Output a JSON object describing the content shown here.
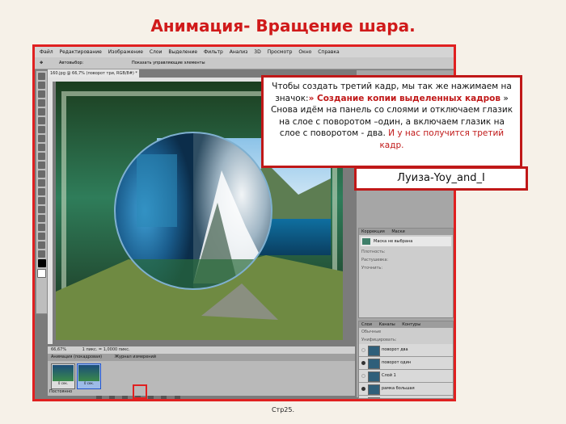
{
  "slide": {
    "title": "Анимация- Вращение шара.",
    "page_number": "Стр25."
  },
  "app": {
    "menu": [
      "Файл",
      "Редактирование",
      "Изображение",
      "Слои",
      "Выделение",
      "Фильтр",
      "Анализ",
      "3D",
      "Просмотр",
      "Окно",
      "Справка"
    ],
    "options_bar": {
      "autoselect": "Автовыбор:",
      "show_controls": "Показать управляющие элементы"
    },
    "document_tab": "160.jpg @ 66,7% (поворот три, RGB/8#) *",
    "status": {
      "zoom": "66,67%",
      "info": "1 пикс. = 1,0000 пикс."
    }
  },
  "animation_panel": {
    "tabs": [
      "Анимация (покадровая)",
      "Журнал измерений"
    ],
    "frames": [
      {
        "number": "1",
        "delay": "0 сек."
      },
      {
        "number": "2",
        "delay": "0 сек."
      }
    ],
    "loop": "Постоянно"
  },
  "masks_panel": {
    "tabs": [
      "Коррекция",
      "Маски"
    ],
    "mask_label": "Маска не выбрана",
    "fields": [
      "Плотность:",
      "Растушевка:",
      "Уточнить:"
    ]
  },
  "layers_panel": {
    "tabs": [
      "Слои",
      "Каналы",
      "Контуры"
    ],
    "blend_mode": "Обычные",
    "unify": "Унифицировать:",
    "layers": [
      {
        "name": "поворот два",
        "visible": false,
        "selected": false
      },
      {
        "name": "поворот один",
        "visible": true,
        "selected": false
      },
      {
        "name": "Слой 1",
        "visible": false,
        "selected": false
      },
      {
        "name": "рамка большая",
        "visible": true,
        "selected": false
      },
      {
        "name": "фон два",
        "visible": true,
        "selected": false
      },
      {
        "name": "главный",
        "visible": true,
        "selected": false
      }
    ]
  },
  "callout": {
    "text_before": "Чтобы создать третий кадр, мы так же нажимаем на значок:",
    "highlight_bold": "» Создание копии выделенных кадров",
    "text_middle": "» Снова идём на панель со слоями и отключаем глазик на слое с поворотом –один, а включаем глазик на слое с поворотом - два.",
    "highlight_end": "И у нас получится третий кадр."
  },
  "author": "Луиза-Yoy_and_I",
  "colors": {
    "accent_red": "#d01a1a",
    "slide_background": "#f6f1e8"
  }
}
